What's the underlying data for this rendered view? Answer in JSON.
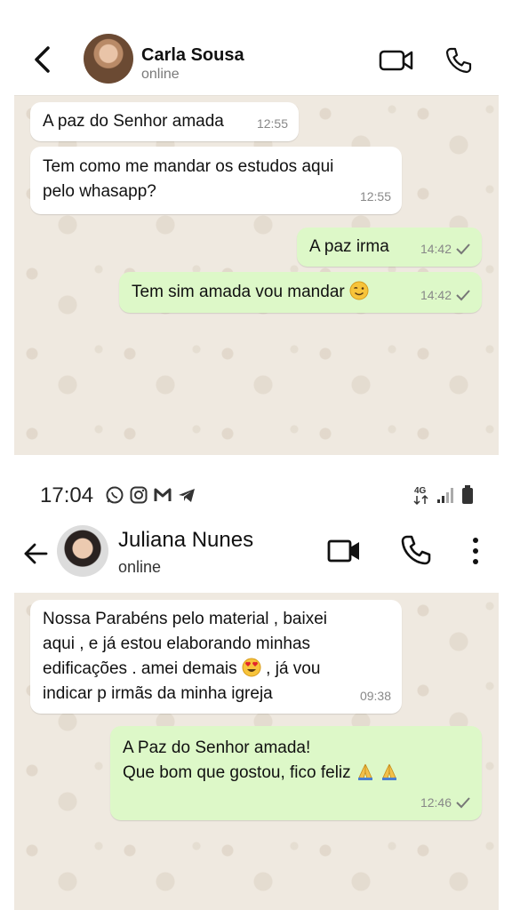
{
  "chat1": {
    "contact_name": "Carla Sousa",
    "status": "online",
    "messages": [
      {
        "dir": "in",
        "text": "A paz do Senhor amada",
        "time": "12:55"
      },
      {
        "dir": "in",
        "line1": "Tem como me mandar os estudos aqui",
        "line2": "pelo whasapp?",
        "time": "12:55"
      },
      {
        "dir": "out",
        "text": "A paz irma",
        "time": "14:42"
      },
      {
        "dir": "out",
        "text": "Tem sim amada vou mandar",
        "emoji": "wink-emoji",
        "time": "14:42"
      }
    ]
  },
  "chat2": {
    "status_bar": {
      "time": "17:04",
      "network": "4G",
      "icons": [
        "whatsapp-icon",
        "instagram-icon",
        "gmail-icon",
        "telegram-icon"
      ]
    },
    "contact_name": "Juliana Nunes",
    "status": "online",
    "messages": [
      {
        "dir": "in",
        "line1": "Nossa Parabéns pelo material , baixei",
        "line2": "aqui , e já estou elaborando minhas",
        "line3a": "edificações . amei demais",
        "line3b": ", já vou",
        "line4": "indicar p irmãs da minha igreja",
        "emoji": "heart-eyes-emoji",
        "time": "09:38"
      },
      {
        "dir": "out",
        "line1": "A Paz do Senhor amada!",
        "line2": "Que bom que gostou, fico feliz",
        "emoji": "praying-hands-emoji",
        "time": "12:46"
      }
    ]
  },
  "colors": {
    "incoming": "#ffffff",
    "outgoing": "#ddf8c8",
    "wallpaper": "#efe9e0"
  }
}
